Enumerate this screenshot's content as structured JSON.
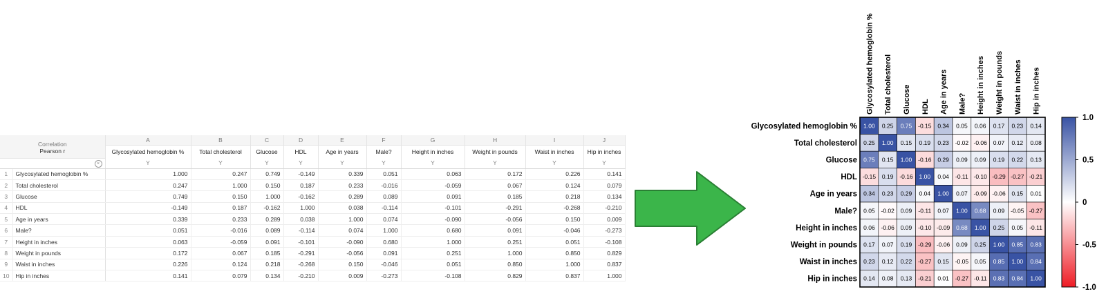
{
  "sheet": {
    "corner_line1": "Correlation",
    "corner_line2": "Pearson r",
    "column_letters": [
      "A",
      "B",
      "C",
      "D",
      "E",
      "F",
      "G",
      "H",
      "I",
      "J"
    ],
    "column_headers": [
      "Glycosylated hemoglobin %",
      "Total cholesterol",
      "Glucose",
      "HDL",
      "Age in years",
      "Male?",
      "Height in inches",
      "Weight in pounds",
      "Waist in inches",
      "Hip in inches"
    ],
    "column_type": "Y",
    "rows": [
      {
        "num": "1",
        "label": "Glycosylated hemoglobin %",
        "values": [
          "1.000",
          "0.247",
          "0.749",
          "-0.149",
          "0.339",
          "0.051",
          "0.063",
          "0.172",
          "0.226",
          "0.141"
        ]
      },
      {
        "num": "2",
        "label": "Total cholesterol",
        "values": [
          "0.247",
          "1.000",
          "0.150",
          "0.187",
          "0.233",
          "-0.016",
          "-0.059",
          "0.067",
          "0.124",
          "0.079"
        ]
      },
      {
        "num": "3",
        "label": "Glucose",
        "values": [
          "0.749",
          "0.150",
          "1.000",
          "-0.162",
          "0.289",
          "0.089",
          "0.091",
          "0.185",
          "0.218",
          "0.134"
        ]
      },
      {
        "num": "4",
        "label": "HDL",
        "values": [
          "-0.149",
          "0.187",
          "-0.162",
          "1.000",
          "0.038",
          "-0.114",
          "-0.101",
          "-0.291",
          "-0.268",
          "-0.210"
        ]
      },
      {
        "num": "5",
        "label": "Age in years",
        "values": [
          "0.339",
          "0.233",
          "0.289",
          "0.038",
          "1.000",
          "0.074",
          "-0.090",
          "-0.056",
          "0.150",
          "0.009"
        ]
      },
      {
        "num": "6",
        "label": "Male?",
        "values": [
          "0.051",
          "-0.016",
          "0.089",
          "-0.114",
          "0.074",
          "1.000",
          "0.680",
          "0.091",
          "-0.046",
          "-0.273"
        ]
      },
      {
        "num": "7",
        "label": "Height in inches",
        "values": [
          "0.063",
          "-0.059",
          "0.091",
          "-0.101",
          "-0.090",
          "0.680",
          "1.000",
          "0.251",
          "0.051",
          "-0.108"
        ]
      },
      {
        "num": "8",
        "label": "Weight in pounds",
        "values": [
          "0.172",
          "0.067",
          "0.185",
          "-0.291",
          "-0.056",
          "0.091",
          "0.251",
          "1.000",
          "0.850",
          "0.829"
        ]
      },
      {
        "num": "9",
        "label": "Waist in inches",
        "values": [
          "0.226",
          "0.124",
          "0.218",
          "-0.268",
          "0.150",
          "-0.046",
          "0.051",
          "0.850",
          "1.000",
          "0.837"
        ]
      },
      {
        "num": "10",
        "label": "Hip in inches",
        "values": [
          "0.141",
          "0.079",
          "0.134",
          "-0.210",
          "0.009",
          "-0.273",
          "-0.108",
          "0.829",
          "0.837",
          "1.000"
        ]
      }
    ]
  },
  "arrow": {
    "color": "#3bb54a",
    "stroke": "#2a7f34"
  },
  "chart_data": {
    "type": "heatmap",
    "labels": [
      "Glycosylated hemoglobin %",
      "Total cholesterol",
      "Glucose",
      "HDL",
      "Age in years",
      "Male?",
      "Height in inches",
      "Weight in pounds",
      "Waist in inches",
      "Hip in inches"
    ],
    "matrix": [
      [
        1.0,
        0.25,
        0.75,
        -0.15,
        0.34,
        0.05,
        0.06,
        0.17,
        0.23,
        0.14
      ],
      [
        0.25,
        1.0,
        0.15,
        0.19,
        0.23,
        -0.02,
        -0.06,
        0.07,
        0.12,
        0.08
      ],
      [
        0.75,
        0.15,
        1.0,
        -0.16,
        0.29,
        0.09,
        0.09,
        0.19,
        0.22,
        0.13
      ],
      [
        -0.15,
        0.19,
        -0.16,
        1.0,
        0.04,
        -0.11,
        -0.1,
        -0.29,
        -0.27,
        -0.21
      ],
      [
        0.34,
        0.23,
        0.29,
        0.04,
        1.0,
        0.07,
        -0.09,
        -0.06,
        0.15,
        0.01
      ],
      [
        0.05,
        -0.02,
        0.09,
        -0.11,
        0.07,
        1.0,
        0.68,
        0.09,
        -0.05,
        -0.27
      ],
      [
        0.06,
        -0.06,
        0.09,
        -0.1,
        -0.09,
        0.68,
        1.0,
        0.25,
        0.05,
        -0.11
      ],
      [
        0.17,
        0.07,
        0.19,
        -0.29,
        -0.06,
        0.09,
        0.25,
        1.0,
        0.85,
        0.83
      ],
      [
        0.23,
        0.12,
        0.22,
        -0.27,
        0.15,
        -0.05,
        0.05,
        0.85,
        1.0,
        0.84
      ],
      [
        0.14,
        0.08,
        0.13,
        -0.21,
        0.01,
        -0.27,
        -0.11,
        0.83,
        0.84,
        1.0
      ]
    ],
    "colorbar_ticks": [
      "1.0",
      "0.5",
      "0",
      "-0.5",
      "-1.0"
    ],
    "vmin": -1.0,
    "vmax": 1.0,
    "colors": {
      "positive": "#3953a4",
      "zero": "#ffffff",
      "negative": "#ee1c25"
    }
  }
}
